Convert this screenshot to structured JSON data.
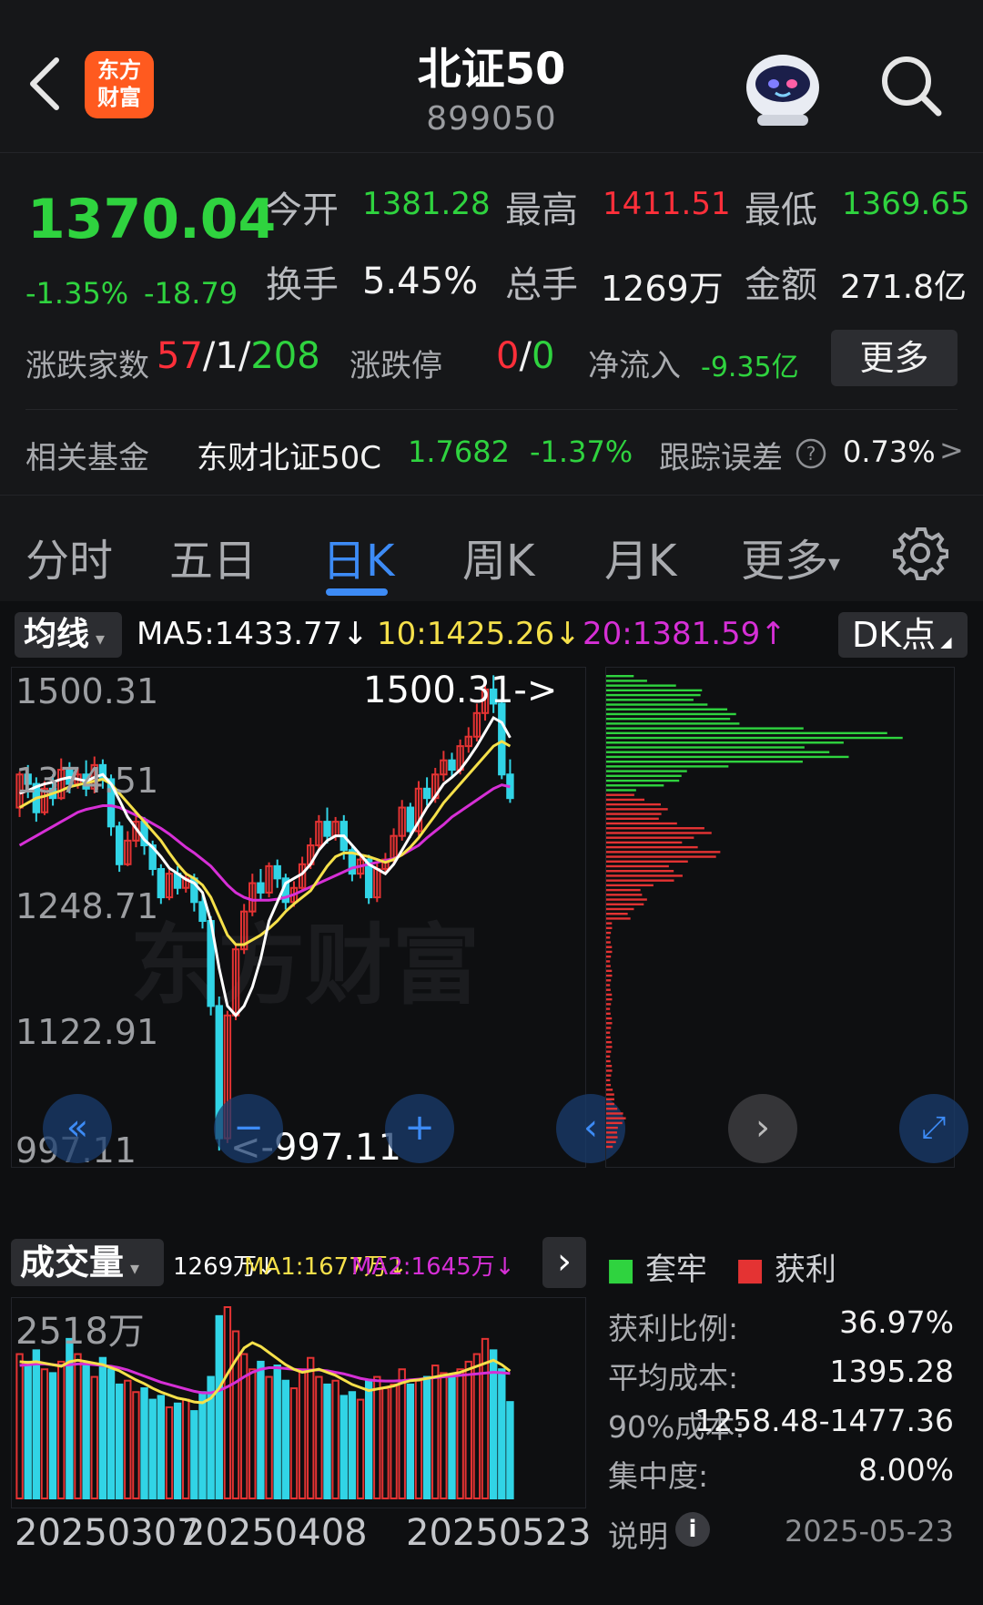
{
  "header": {
    "title": "北证50",
    "code": "899050",
    "brand_line1": "东方",
    "brand_line2": "财富"
  },
  "quote": {
    "price": "1370.04",
    "change_pct": "-1.35%",
    "change_abs": "-18.79",
    "open_label": "今开",
    "open": "1381.28",
    "high_label": "最高",
    "high": "1411.51",
    "low_label": "最低",
    "low": "1369.65",
    "turnover_label": "换手",
    "turnover": "5.45%",
    "volume_label": "总手",
    "volume": "1269万",
    "amount_label": "金额",
    "amount": "271.8亿",
    "breadth_label": "涨跌家数",
    "breadth_up": "57",
    "breadth_sep1": "/",
    "breadth_flat": "1",
    "breadth_sep2": "/",
    "breadth_down": "208",
    "limit_label": "涨跌停",
    "limit_up": "0",
    "limit_sep": "/",
    "limit_down": "0",
    "inflow_label": "净流入",
    "inflow": "-9.35亿",
    "more_label": "更多",
    "fund_label": "相关基金",
    "fund_name": "东财北证50C",
    "fund_price": "1.7682",
    "fund_change": "-1.37%",
    "tracking_label": "跟踪误差",
    "tracking_value": "0.73%",
    "tracking_arrow": ">"
  },
  "tabs": [
    {
      "label": "分时"
    },
    {
      "label": "五日"
    },
    {
      "label": "日K"
    },
    {
      "label": "周K"
    },
    {
      "label": "月K"
    },
    {
      "label": "更多"
    }
  ],
  "indicators": {
    "ma_select": "均线",
    "ma5": "MA5:1433.77↓",
    "ma10": "10:1425.26↓",
    "ma20": "20:1381.59↑",
    "dk": "DK点",
    "colors": {
      "ma5": "#ffffff",
      "ma10": "#f5e04a",
      "ma20": "#d62fd6",
      "up": "#e43333",
      "down": "#31d4e6"
    }
  },
  "kline": {
    "y_labels": [
      "1500.31",
      "1374.51",
      "1248.71",
      "1122.91",
      "997.11"
    ],
    "max_marker": "1500.31->",
    "min_marker": "<-997.11",
    "watermark": "东方财富"
  },
  "volume": {
    "select": "成交量",
    "current": "1269万↓",
    "ma1": "MA1:1677万↓",
    "ma2": "MA2:1645万↓",
    "max_label": "2518万",
    "dates": [
      "20250307",
      "20250408",
      "20250523"
    ]
  },
  "cost": {
    "legend_trapped": "套牢",
    "legend_profit": "获利",
    "profit_ratio_label": "获利比例:",
    "profit_ratio": "36.97%",
    "avg_cost_label": "平均成本:",
    "avg_cost": "1395.28",
    "cost90_label": "90%成本:",
    "cost90": "1258.48-1477.36",
    "concentration_label": "集中度:",
    "concentration": "8.00%",
    "note_label": "说明",
    "date": "2025-05-23"
  },
  "chart_data": {
    "type": "candlestick",
    "title": "",
    "ylim": [
      997.11,
      1500.31
    ],
    "y_ticks": [
      1500.31,
      1374.51,
      1248.71,
      1122.91,
      997.11
    ],
    "x_ticks": [
      "20250307",
      "20250408",
      "20250523"
    ],
    "candles": [
      [
        1360,
        1395,
        1350,
        1398
      ],
      [
        1395,
        1385,
        1370,
        1405
      ],
      [
        1385,
        1355,
        1345,
        1392
      ],
      [
        1355,
        1380,
        1352,
        1388
      ],
      [
        1380,
        1370,
        1362,
        1395
      ],
      [
        1370,
        1400,
        1368,
        1412
      ],
      [
        1400,
        1385,
        1375,
        1408
      ],
      [
        1385,
        1395,
        1380,
        1402
      ],
      [
        1395,
        1380,
        1372,
        1410
      ],
      [
        1380,
        1405,
        1375,
        1414
      ],
      [
        1405,
        1390,
        1380,
        1411
      ],
      [
        1390,
        1340,
        1330,
        1395
      ],
      [
        1340,
        1300,
        1292,
        1345
      ],
      [
        1300,
        1325,
        1298,
        1335
      ],
      [
        1325,
        1345,
        1318,
        1352
      ],
      [
        1345,
        1320,
        1310,
        1350
      ],
      [
        1320,
        1295,
        1288,
        1325
      ],
      [
        1295,
        1265,
        1258,
        1300
      ],
      [
        1265,
        1290,
        1262,
        1296
      ],
      [
        1290,
        1275,
        1268,
        1298
      ],
      [
        1275,
        1285,
        1270,
        1292
      ],
      [
        1285,
        1260,
        1250,
        1290
      ],
      [
        1260,
        1240,
        1232,
        1268
      ],
      [
        1240,
        1150,
        1140,
        1245
      ],
      [
        1150,
        1010,
        997,
        1160
      ],
      [
        1010,
        1140,
        1005,
        1145
      ],
      [
        1140,
        1210,
        1135,
        1215
      ],
      [
        1210,
        1250,
        1205,
        1258
      ],
      [
        1250,
        1280,
        1245,
        1290
      ],
      [
        1280,
        1270,
        1262,
        1295
      ],
      [
        1270,
        1298,
        1265,
        1302
      ],
      [
        1298,
        1285,
        1275,
        1305
      ],
      [
        1285,
        1260,
        1252,
        1290
      ],
      [
        1260,
        1275,
        1255,
        1282
      ],
      [
        1275,
        1300,
        1272,
        1308
      ],
      [
        1300,
        1320,
        1295,
        1328
      ],
      [
        1320,
        1345,
        1315,
        1352
      ],
      [
        1345,
        1330,
        1322,
        1360
      ],
      [
        1330,
        1345,
        1325,
        1350
      ],
      [
        1345,
        1315,
        1305,
        1352
      ],
      [
        1315,
        1290,
        1282,
        1320
      ],
      [
        1290,
        1305,
        1285,
        1312
      ],
      [
        1305,
        1265,
        1258,
        1310
      ],
      [
        1265,
        1295,
        1260,
        1302
      ],
      [
        1295,
        1305,
        1290,
        1312
      ],
      [
        1305,
        1330,
        1300,
        1338
      ],
      [
        1330,
        1360,
        1325,
        1368
      ],
      [
        1360,
        1335,
        1328,
        1365
      ],
      [
        1335,
        1380,
        1330,
        1388
      ],
      [
        1380,
        1370,
        1362,
        1392
      ],
      [
        1370,
        1395,
        1365,
        1402
      ],
      [
        1395,
        1410,
        1388,
        1420
      ],
      [
        1410,
        1400,
        1392,
        1418
      ],
      [
        1400,
        1425,
        1395,
        1432
      ],
      [
        1425,
        1435,
        1418,
        1445
      ],
      [
        1435,
        1460,
        1430,
        1470
      ],
      [
        1460,
        1485,
        1452,
        1492
      ],
      [
        1485,
        1470,
        1460,
        1500
      ],
      [
        1470,
        1395,
        1390,
        1475
      ],
      [
        1395,
        1370,
        1365,
        1411
      ]
    ],
    "ma5": [
      1375,
      1378,
      1382,
      1385,
      1387,
      1390,
      1392,
      1390,
      1388,
      1392,
      1395,
      1385,
      1368,
      1350,
      1338,
      1326,
      1318,
      1308,
      1296,
      1290,
      1284,
      1280,
      1270,
      1240,
      1190,
      1150,
      1140,
      1150,
      1170,
      1200,
      1240,
      1260,
      1280,
      1285,
      1290,
      1300,
      1315,
      1325,
      1330,
      1330,
      1320,
      1310,
      1300,
      1295,
      1290,
      1300,
      1315,
      1330,
      1345,
      1360,
      1372,
      1385,
      1392,
      1400,
      1412,
      1425,
      1440,
      1455,
      1450,
      1434
    ],
    "ma10": [
      1360,
      1365,
      1370,
      1372,
      1375,
      1378,
      1382,
      1384,
      1386,
      1388,
      1390,
      1385,
      1375,
      1365,
      1355,
      1345,
      1335,
      1325,
      1312,
      1300,
      1290,
      1285,
      1278,
      1265,
      1245,
      1225,
      1215,
      1215,
      1220,
      1225,
      1232,
      1240,
      1250,
      1258,
      1265,
      1272,
      1285,
      1298,
      1308,
      1312,
      1312,
      1310,
      1308,
      1305,
      1302,
      1305,
      1310,
      1318,
      1328,
      1340,
      1352,
      1365,
      1375,
      1385,
      1395,
      1405,
      1415,
      1425,
      1430,
      1425
    ],
    "ma20": [
      1320,
      1325,
      1330,
      1335,
      1340,
      1345,
      1350,
      1355,
      1358,
      1360,
      1362,
      1362,
      1360,
      1356,
      1352,
      1348,
      1343,
      1338,
      1332,
      1325,
      1318,
      1312,
      1305,
      1298,
      1288,
      1278,
      1270,
      1265,
      1262,
      1262,
      1262,
      1263,
      1265,
      1268,
      1272,
      1276,
      1280,
      1284,
      1288,
      1292,
      1296,
      1298,
      1300,
      1302,
      1304,
      1306,
      1310,
      1315,
      1320,
      1328,
      1335,
      1342,
      1350,
      1356,
      1362,
      1368,
      1374,
      1380,
      1384,
      1382
    ],
    "volume": [
      1900,
      1800,
      1950,
      1700,
      1650,
      1800,
      2100,
      1900,
      1750,
      1600,
      1850,
      1700,
      1500,
      1550,
      1400,
      1450,
      1300,
      1350,
      1200,
      1250,
      1300,
      1150,
      1400,
      1600,
      2400,
      2518,
      2200,
      1900,
      1700,
      1800,
      1600,
      1750,
      1550,
      1450,
      1700,
      1850,
      1600,
      1500,
      1550,
      1350,
      1400,
      1300,
      1550,
      1600,
      1450,
      1500,
      1700,
      1500,
      1550,
      1600,
      1750,
      1650,
      1600,
      1700,
      1800,
      1900,
      2100,
      1950,
      1700,
      1269
    ],
    "vol_ma1": [
      1800,
      1790,
      1800,
      1780,
      1760,
      1740,
      1800,
      1820,
      1800,
      1780,
      1760,
      1720,
      1680,
      1620,
      1560,
      1510,
      1450,
      1400,
      1360,
      1320,
      1300,
      1270,
      1260,
      1320,
      1450,
      1640,
      1820,
      1980,
      2050,
      2000,
      1920,
      1840,
      1760,
      1700,
      1660,
      1680,
      1700,
      1660,
      1620,
      1560,
      1500,
      1460,
      1420,
      1440,
      1460,
      1480,
      1520,
      1550,
      1560,
      1580,
      1600,
      1620,
      1640,
      1660,
      1700,
      1740,
      1780,
      1820,
      1760,
      1677
    ],
    "vol_ma2": [
      1750,
      1760,
      1770,
      1770,
      1760,
      1750,
      1760,
      1770,
      1770,
      1760,
      1750,
      1740,
      1720,
      1690,
      1650,
      1610,
      1570,
      1530,
      1500,
      1470,
      1440,
      1410,
      1390,
      1390,
      1420,
      1470,
      1530,
      1600,
      1660,
      1700,
      1720,
      1720,
      1710,
      1700,
      1690,
      1690,
      1690,
      1680,
      1660,
      1640,
      1610,
      1580,
      1560,
      1550,
      1545,
      1545,
      1550,
      1560,
      1570,
      1580,
      1590,
      1600,
      1610,
      1620,
      1630,
      1640,
      1650,
      1660,
      1655,
      1645
    ],
    "cost_distribution_note": "profit (red) below 1374 / trapped (green) above"
  }
}
